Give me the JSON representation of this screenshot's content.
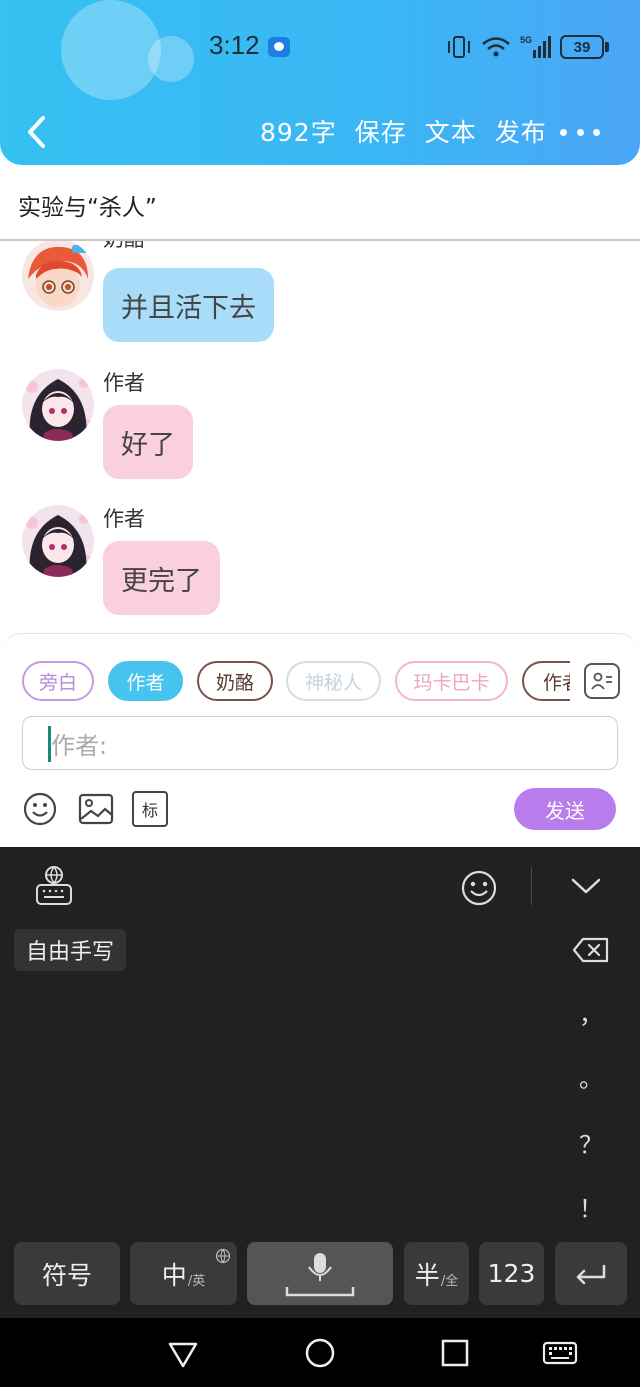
{
  "status_bar": {
    "time": "3:12",
    "network": "5G",
    "battery": "39"
  },
  "toolbar": {
    "back_icon": "chevron-left-icon",
    "word_count": "892字",
    "save_label": "保存",
    "text_label": "文本",
    "publish_label": "发布",
    "more_icon": "more-dots-icon"
  },
  "chapter": {
    "title": "实验与“杀人”"
  },
  "messages": [
    {
      "sender": "奶酪",
      "text": "并且活下去",
      "style": "blue"
    },
    {
      "sender": "作者",
      "text": "好了",
      "style": "pink"
    },
    {
      "sender": "作者",
      "text": "更完了",
      "style": "pink"
    }
  ],
  "composer": {
    "roles": [
      {
        "label": "旁白",
        "selected": false,
        "color": "#c39ae4"
      },
      {
        "label": "作者",
        "selected": true,
        "color": "#46c3ef"
      },
      {
        "label": "奶酪",
        "selected": false,
        "color": "#7b5148"
      },
      {
        "label": "神秘人",
        "selected": false,
        "color": "#d2dde6"
      },
      {
        "label": "玛卡巴卡",
        "selected": false,
        "color": "#f2b7c7"
      },
      {
        "label": "作者",
        "selected": false,
        "color": "#7b5148"
      }
    ],
    "input_placeholder": "作者:",
    "tools": [
      "emoji-icon",
      "image-icon",
      "tag-icon"
    ],
    "tag_label": "标",
    "send_label": "发送"
  },
  "keyboard": {
    "handwriting_label": "自由手写",
    "punctuation": [
      "，",
      "。",
      "？",
      "！"
    ],
    "keys": {
      "symbols": "符号",
      "chinese": "中",
      "chinese_sub": "/英",
      "half": "半",
      "half_sub": "/全",
      "numbers": "123"
    }
  },
  "colors": {
    "header_start": "#35c1f2",
    "header_end": "#4aa6f6",
    "send_button": "#b97cec",
    "bubble_blue": "#a9dcf9",
    "bubble_pink": "#fbd0de",
    "keyboard_bg": "#212121"
  }
}
